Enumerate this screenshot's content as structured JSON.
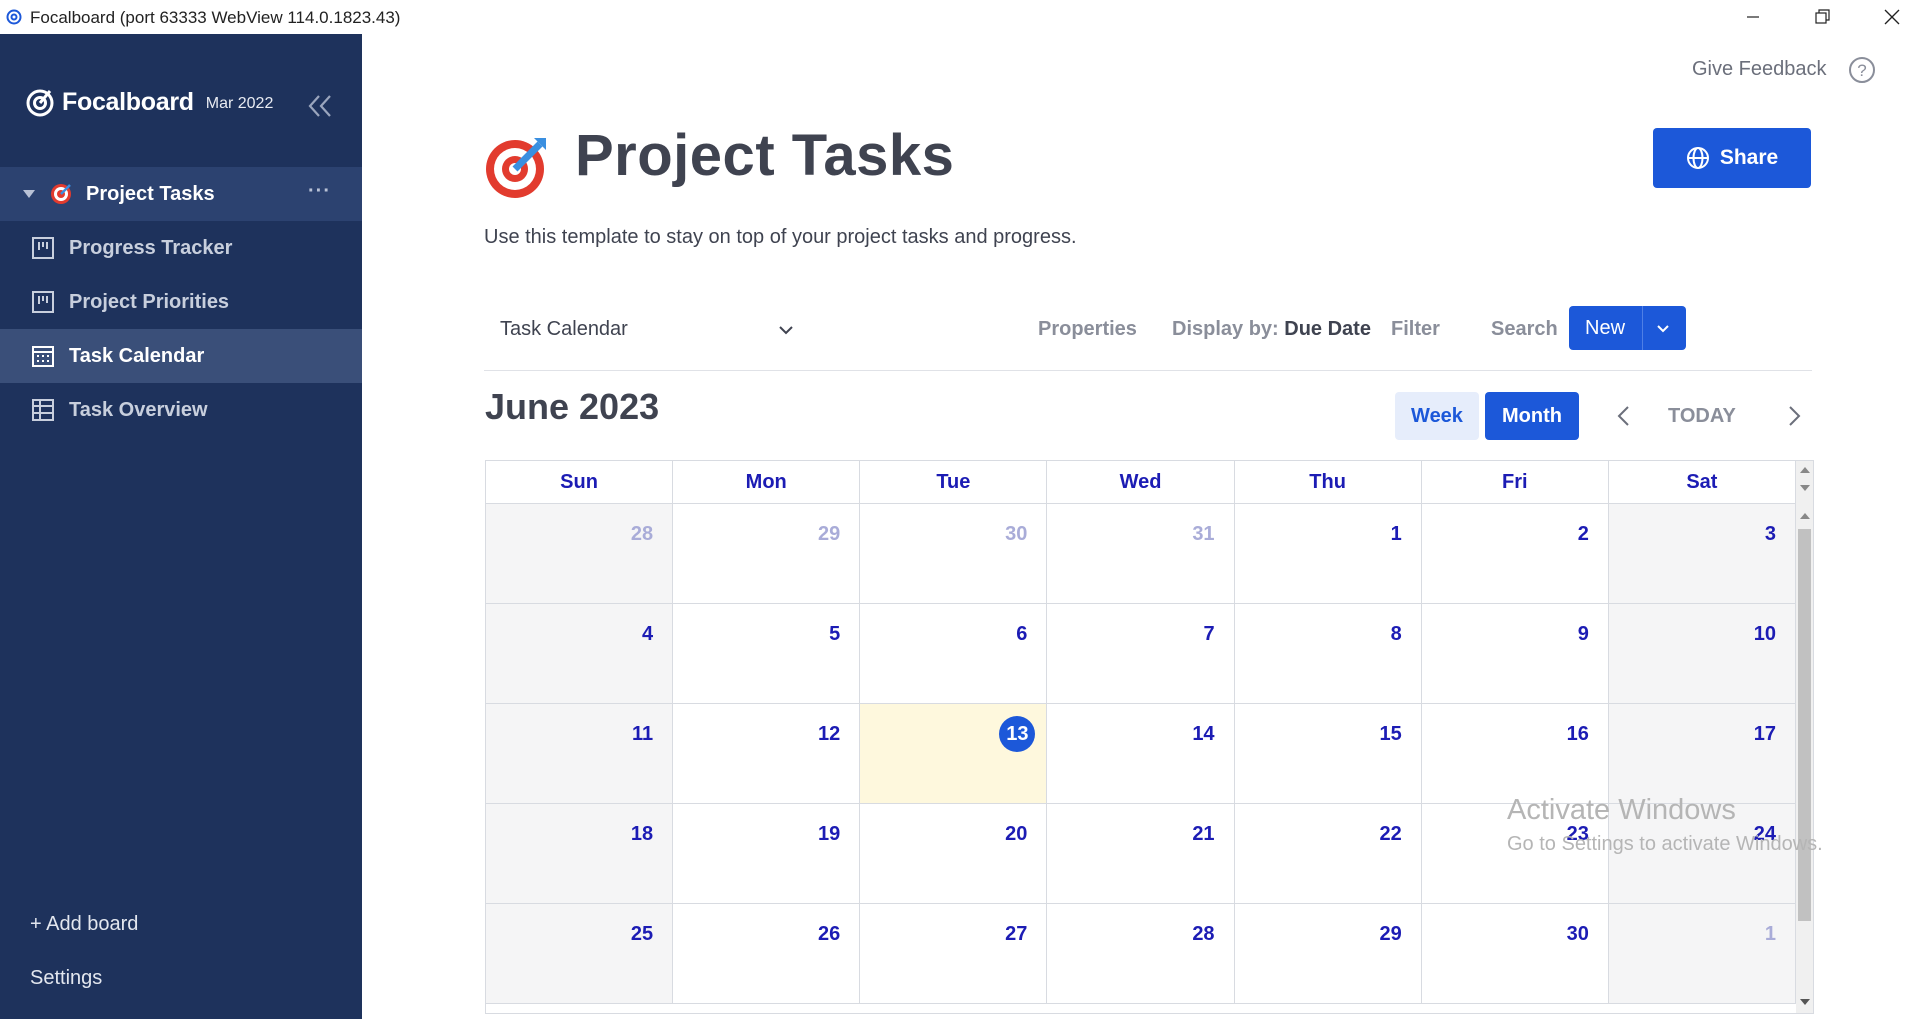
{
  "window": {
    "title": "Focalboard (port 63333 WebView 114.0.1823.43)",
    "controls": [
      "minimize-icon",
      "restore-icon",
      "close-icon"
    ]
  },
  "sidebar": {
    "brand": "Focalboard",
    "version": "Mar 2022",
    "board": "Project Tasks",
    "views": [
      {
        "label": "Progress Tracker",
        "icon": "board-icon"
      },
      {
        "label": "Project Priorities",
        "icon": "board-icon"
      },
      {
        "label": "Task Calendar",
        "icon": "calendar-icon"
      },
      {
        "label": "Task Overview",
        "icon": "table-icon"
      }
    ],
    "add_board": "+ Add board",
    "settings": "Settings"
  },
  "header": {
    "feedback": "Give Feedback",
    "title": "Project Tasks",
    "share": "Share",
    "description": "Use this template to stay on top of your project tasks and progress."
  },
  "viewbar": {
    "view_name": "Task Calendar",
    "properties": "Properties",
    "display_by_label": "Display by:",
    "display_by_value": "Due Date",
    "filter": "Filter",
    "search": "Search",
    "more": "···",
    "new": "New"
  },
  "calendar": {
    "title": "June 2023",
    "week": "Week",
    "month": "Month",
    "today": "TODAY",
    "days": [
      "Sun",
      "Mon",
      "Tue",
      "Wed",
      "Thu",
      "Fri",
      "Sat"
    ],
    "weeks": [
      [
        {
          "d": "28",
          "other": true
        },
        {
          "d": "29",
          "other": true
        },
        {
          "d": "30",
          "other": true
        },
        {
          "d": "31",
          "other": true
        },
        {
          "d": "1"
        },
        {
          "d": "2"
        },
        {
          "d": "3"
        }
      ],
      [
        {
          "d": "4"
        },
        {
          "d": "5"
        },
        {
          "d": "6"
        },
        {
          "d": "7"
        },
        {
          "d": "8"
        },
        {
          "d": "9"
        },
        {
          "d": "10"
        }
      ],
      [
        {
          "d": "11"
        },
        {
          "d": "12"
        },
        {
          "d": "13",
          "today": true
        },
        {
          "d": "14"
        },
        {
          "d": "15"
        },
        {
          "d": "16"
        },
        {
          "d": "17"
        }
      ],
      [
        {
          "d": "18"
        },
        {
          "d": "19"
        },
        {
          "d": "20"
        },
        {
          "d": "21"
        },
        {
          "d": "22"
        },
        {
          "d": "23"
        },
        {
          "d": "24"
        }
      ],
      [
        {
          "d": "25"
        },
        {
          "d": "26"
        },
        {
          "d": "27"
        },
        {
          "d": "28"
        },
        {
          "d": "29"
        },
        {
          "d": "30"
        },
        {
          "d": "1",
          "other": true
        }
      ]
    ]
  },
  "watermark": {
    "line1": "Activate Windows",
    "line2": "Go to Settings to activate Windows."
  },
  "colors": {
    "sidebar_bg": "#1e325c",
    "accent": "#1c58d9",
    "day_text": "#1c1cb4",
    "today_cell": "#fef8dd"
  }
}
